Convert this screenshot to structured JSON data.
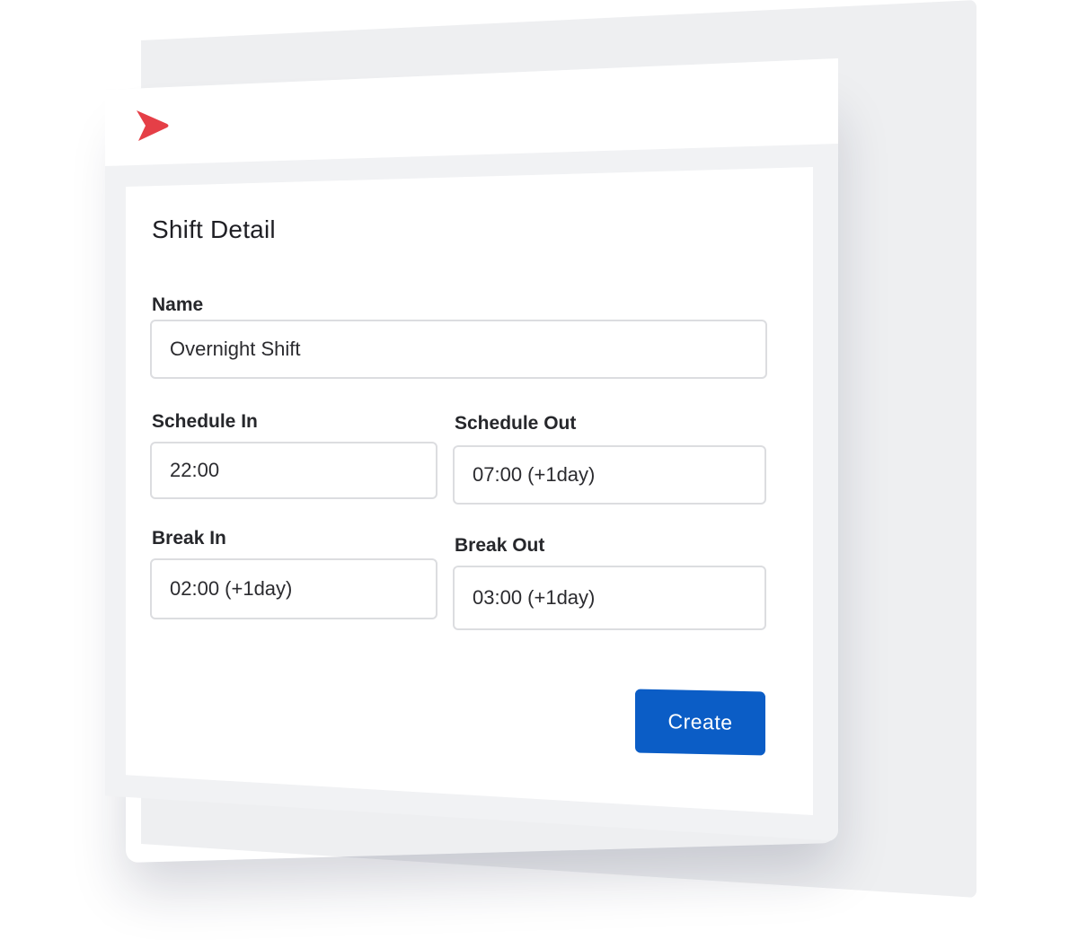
{
  "app": {
    "logo_icon": "red-chevron-logo",
    "brand_color": "#e53f47"
  },
  "form": {
    "title": "Shift Detail",
    "name_label": "Name",
    "name_value": "Overnight Shift",
    "schedule_in_label": "Schedule In",
    "schedule_in_value": "22:00",
    "schedule_out_label": "Schedule Out",
    "schedule_out_value": "07:00 (+1day)",
    "break_in_label": "Break In",
    "break_in_value": "02:00 (+1day)",
    "break_out_label": "Break Out",
    "break_out_value": "03:00 (+1day)",
    "create_label": "Create",
    "accent_color": "#0b5dc6"
  }
}
